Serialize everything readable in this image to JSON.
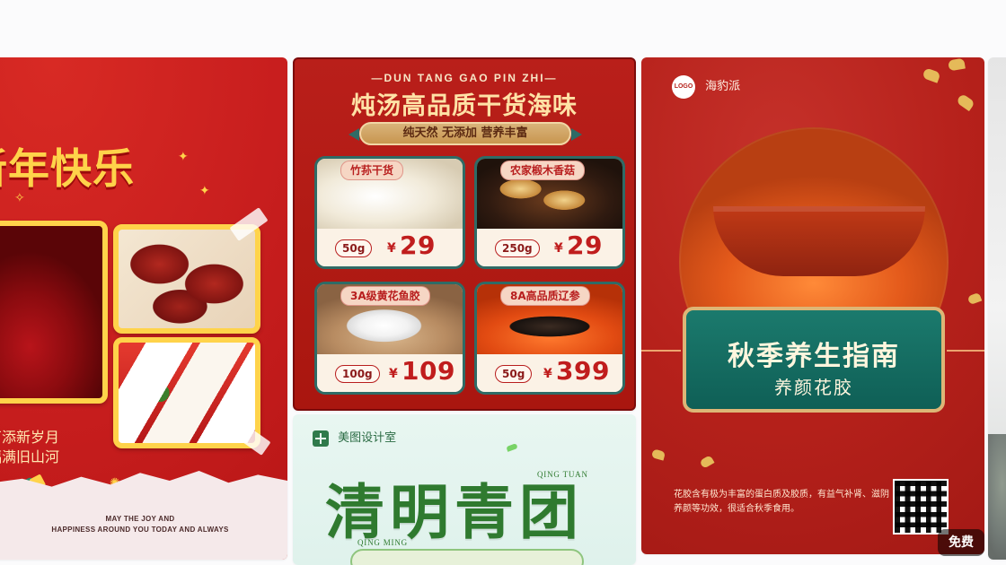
{
  "cards": {
    "left": {
      "title": "新年快乐",
      "couplet_line_1": "万添新岁月",
      "couplet_line_2": "福满旧山河",
      "footer_line_1": "MAY THE JOY AND",
      "footer_line_2": "HAPPINESS AROUND YOU TODAY AND ALWAYS"
    },
    "middle_top": {
      "subtitle": "—DUN TANG GAO PIN ZHI—",
      "title": "炖汤高品质干货海味",
      "badge": "纯天然 无添加 营养丰富",
      "items": [
        {
          "name": "竹荪干货",
          "weight": "50g",
          "currency": "¥",
          "price": "29"
        },
        {
          "name": "农家椴木香菇",
          "weight": "250g",
          "currency": "¥",
          "price": "29"
        },
        {
          "name": "3A级黄花鱼胶",
          "weight": "100g",
          "currency": "¥",
          "price": "109"
        },
        {
          "name": "8A高品质辽参",
          "weight": "50g",
          "currency": "¥",
          "price": "399"
        }
      ]
    },
    "middle_bottom": {
      "brand": "美图设计室",
      "title": "清明青团",
      "tag_top": "QING TUAN",
      "tag_bottom": "QING MING"
    },
    "right": {
      "brand_logo": "LOGO",
      "brand_name": "海豹派",
      "title": "秋季养生指南",
      "subtitle": "养颜花胶",
      "description": "花胶含有极为丰富的蛋白质及胶质，有益气补肾、滋阴养颜等功效，很适合秋季食用。"
    }
  },
  "badges": {
    "free": "免费"
  },
  "colors": {
    "page_bg": "#fbfbfc",
    "red": "#c81e1e",
    "gold": "#ffd34a",
    "teal": "#1b7a6d",
    "mint": "#e8f6f1"
  }
}
